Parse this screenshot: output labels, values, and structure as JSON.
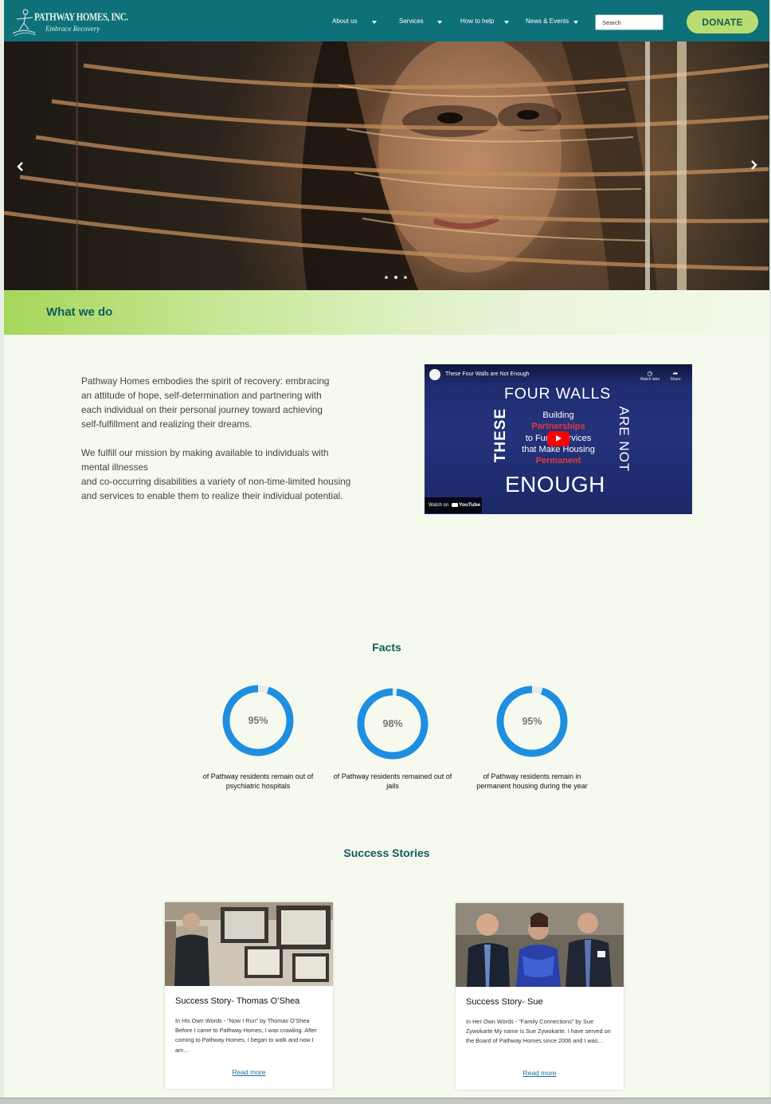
{
  "brand": {
    "name": "PATHWAY HOMES, INC.",
    "tagline": "Embrace Recovery"
  },
  "nav": {
    "items": [
      {
        "label": "About us"
      },
      {
        "label": "Services"
      },
      {
        "label": "How to help"
      },
      {
        "label": "News & Events"
      }
    ],
    "search_placeholder": "Search",
    "donate_label": "DONATE"
  },
  "hero": {
    "slide_count": 3,
    "active_slide": 2
  },
  "what_we_do": {
    "title": "What we do",
    "paragraph1": "Pathway Homes embodies the spirit of recovery: embracing\nan attitude of hope, self-determination and partnering with\neach individual on their personal journey toward achieving\nself-fulfillment and realizing their dreams.",
    "paragraph2": "We fulfill our mission by making available to individuals with\nmental illnesses\nand co-occurring disabilities a variety of non-time-limited housing\nand services to enable them to realize their individual potential."
  },
  "video": {
    "title": "These Four Walls are Not Enough",
    "watch_later": "Watch later",
    "share": "Share",
    "watch_on": "Watch on",
    "youtube": "YouTube",
    "thumb": {
      "top": "FOUR WALLS",
      "left": "THESE",
      "right": "ARE NOT",
      "bottom": "ENOUGH",
      "line1": "Building",
      "line2": "Partnerships",
      "line3": "to Fund Services",
      "line4": "that Make Housing",
      "line5": "Permanent"
    }
  },
  "facts": {
    "title": "Facts",
    "items": [
      {
        "value": "95%",
        "fraction": 0.95,
        "caption": "of Pathway residents remain out of psychiatric hospitals"
      },
      {
        "value": "98%",
        "fraction": 0.98,
        "caption": "of Pathway residents remained out of jails"
      },
      {
        "value": "95%",
        "fraction": 0.95,
        "caption": "of Pathway residents remain in permanent housing during the year"
      }
    ],
    "ring_color": "#1e8ee0",
    "ring_track_color": "#e8ebee"
  },
  "stories": {
    "title": "Success Stories",
    "items": [
      {
        "title": "Success Story- Thomas O’Shea",
        "excerpt": "In His Own Words  - “Now I Run” by Thomas O’Shea Before I came to Pathway Homes, I was crawling. After coming to Pathway Homes, I began to walk and now I am…",
        "link": "Read more"
      },
      {
        "title": "Success Story- Sue",
        "excerpt": "In Her Own Words  - “Family Connections” by Sue Zywokarte My name is Sue Zywokarte. I have served on the Board of Pathway Homes since 2006 and I was…",
        "link": "Read more"
      }
    ]
  },
  "colors": {
    "header": "#0e7078",
    "accent_green": "#b7dd72",
    "heading": "#0f5c60",
    "link": "#1b6d9c"
  }
}
